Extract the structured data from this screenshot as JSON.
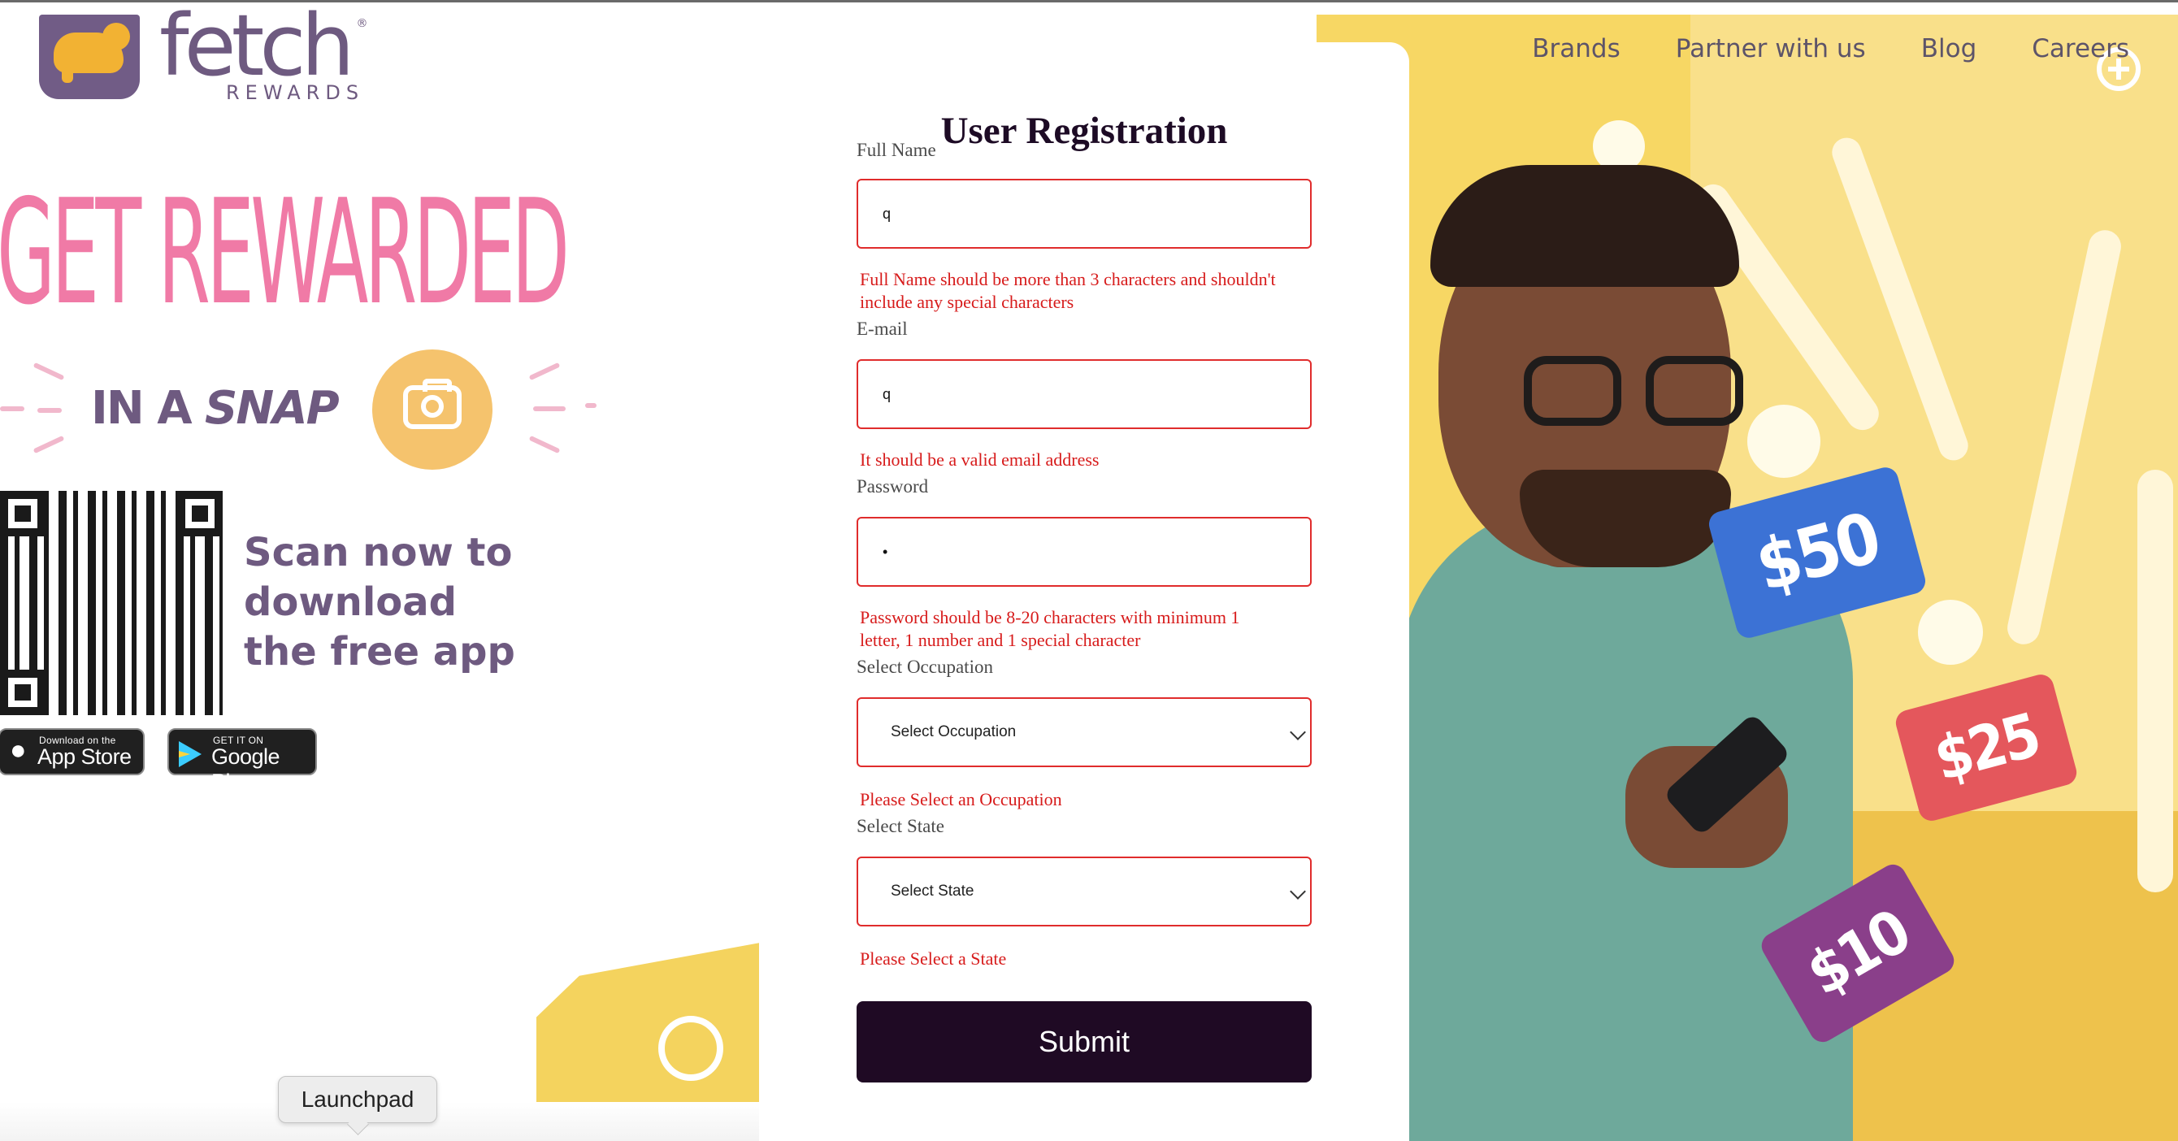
{
  "brand": {
    "wordmark": "fetch",
    "sub": "REWARDS",
    "trademark": "®",
    "colors": {
      "primary": "#6e5a80",
      "accent_pink": "#f07aa6",
      "dark": "#1f0a24",
      "error": "#d71b1b",
      "hero_yellow": "#f7d764"
    }
  },
  "nav": {
    "items": [
      "Brands",
      "Partner with us",
      "Blog",
      "Careers"
    ]
  },
  "promo": {
    "headline": "GET REWARDED",
    "snap_prefix": "IN A ",
    "snap_word": "SNAP",
    "camera_icon": "camera-icon",
    "scan_text": "Scan now to download the free app",
    "app_store": {
      "small": "Download on the",
      "big": "App Store",
      "icon": "apple-icon"
    },
    "google_play": {
      "small": "GET IT ON",
      "big": "Google Play",
      "icon": "play-icon"
    }
  },
  "hero": {
    "tickets": [
      "$50",
      "$25",
      "$10"
    ]
  },
  "form": {
    "title": "User Registration",
    "full_name": {
      "label": "Full Name",
      "value": "q",
      "error": "Full Name should be more than 3 characters and shouldn't include any special characters"
    },
    "email": {
      "label": "E-mail",
      "value": "q",
      "error": "It should be a valid email address"
    },
    "password": {
      "label": "Password",
      "value": "•",
      "error": "Password should be 8-20 characters with minimum 1 letter, 1 number and 1 special character"
    },
    "occupation": {
      "label": "Select Occupation",
      "selected": "Select Occupation",
      "error": "Please Select an Occupation"
    },
    "state": {
      "label": "Select State",
      "selected": "Select State",
      "error": "Please Select a State"
    },
    "submit_label": "Submit"
  },
  "os": {
    "dock_tooltip": "Launchpad"
  }
}
